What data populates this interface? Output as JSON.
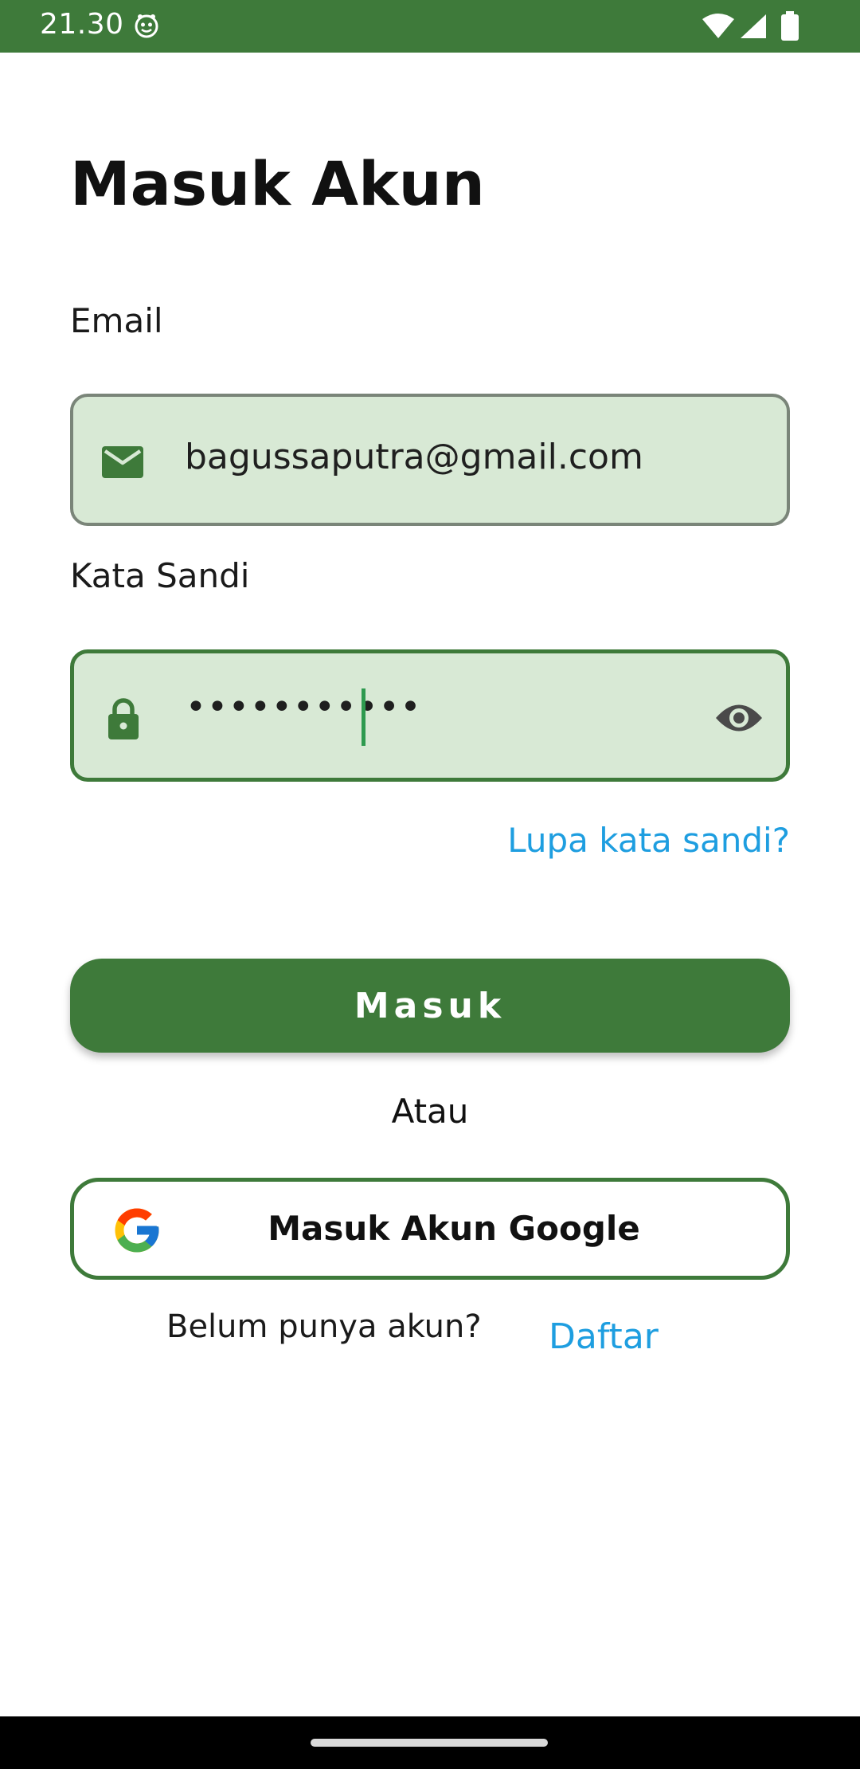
{
  "status_bar": {
    "time": "21.30",
    "icons": [
      "face-notification-icon",
      "wifi-icon",
      "signal-icon",
      "battery-icon"
    ]
  },
  "login": {
    "title": "Masuk Akun",
    "email_label": "Email",
    "email_value": "bagussaputra@gmail.com",
    "email_icon": "mail-icon",
    "password_label": "Kata Sandi",
    "password_value": "•••••••••••",
    "password_icon": "lock-icon",
    "visibility_icon": "eye-icon",
    "forgot_label": "Lupa kata sandi?",
    "submit_label": "Masuk",
    "or_label": "Atau",
    "google_label": "Masuk Akun Google",
    "no_account_label": "Belum punya akun?",
    "register_label": "Daftar"
  },
  "colors": {
    "primary": "#3e7a3a",
    "field_bg": "#d8e9d5",
    "link": "#1e9ee0"
  }
}
